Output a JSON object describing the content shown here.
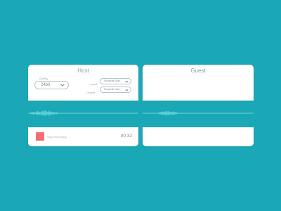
{
  "host": {
    "title": "Host",
    "quality_label": "Quality",
    "quality_value": "24bit",
    "input_label": "Input",
    "input_value": "Focusrite Scar...",
    "output_label": "Output",
    "output_value": "Focusrite Scar...",
    "stop_label": "Stop Recording",
    "timer": "00:32"
  },
  "guest": {
    "title": "Guest"
  },
  "colors": {
    "background": "#1aa8b6",
    "panel": "#ffffff",
    "stop": "#ef6f74",
    "waveform": "#7fe3e6"
  },
  "icons": {
    "quality_chevron": "chevron-down-icon",
    "input_chevron": "chevron-down-icon",
    "output_chevron": "chevron-down-icon",
    "stop": "stop-square-icon"
  }
}
